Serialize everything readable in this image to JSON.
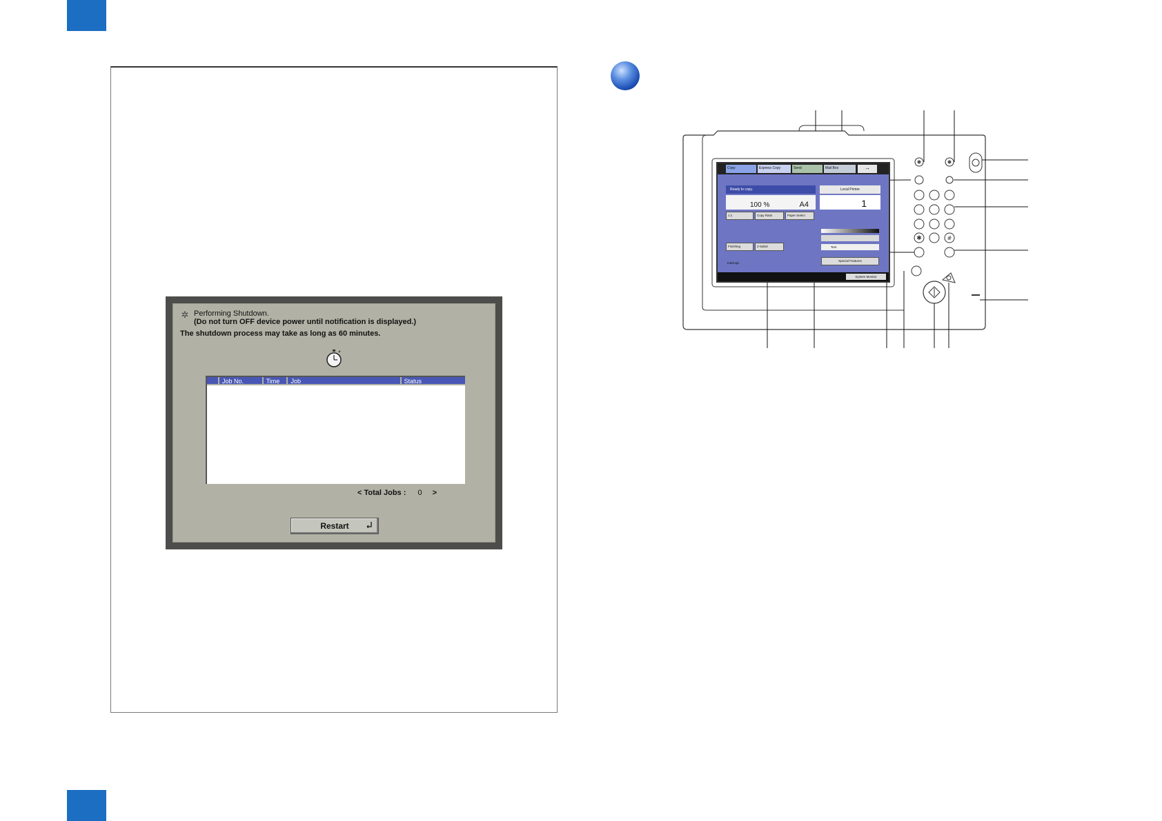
{
  "shutdown_dialog": {
    "title": "Performing Shutdown.",
    "warning": "(Do not turn OFF device power until notification is displayed.)",
    "duration_note": "The shutdown process may take as long as 60 minutes.",
    "table": {
      "columns": [
        "Job No.",
        "Time",
        "Job",
        "Status"
      ],
      "rows": []
    },
    "total_jobs_prefix": "< Total Jobs :",
    "total_jobs_count": "0",
    "total_jobs_suffix": ">",
    "restart_label": "Restart"
  },
  "control_panel": {
    "tabs": {
      "copy": "Copy",
      "express_copy": "Express Copy",
      "send": "Send",
      "mail_box": "Mail Box",
      "more": "→"
    },
    "status_message": "Ready to copy.",
    "copy_ratio_value": "100 %",
    "paper_size_value": "A4",
    "buttons": {
      "one_to_one": "1:1",
      "copy_ratio": "Copy Ratio",
      "paper_select": "Paper Select",
      "finishing": "Finishing",
      "two_sided": "2-Sided",
      "interrupt": "Interrupt",
      "special_features": "Special Features",
      "system_monitor": "System Monitor"
    },
    "printer_label": "Local Printer",
    "copy_count": "1",
    "text_mode": "Text"
  },
  "colors": {
    "corner_blue": "#1b6ec2",
    "dialog_bg": "#b1b2a5",
    "table_header": "#4857b5",
    "lcd_bg": "#6e76c3"
  }
}
